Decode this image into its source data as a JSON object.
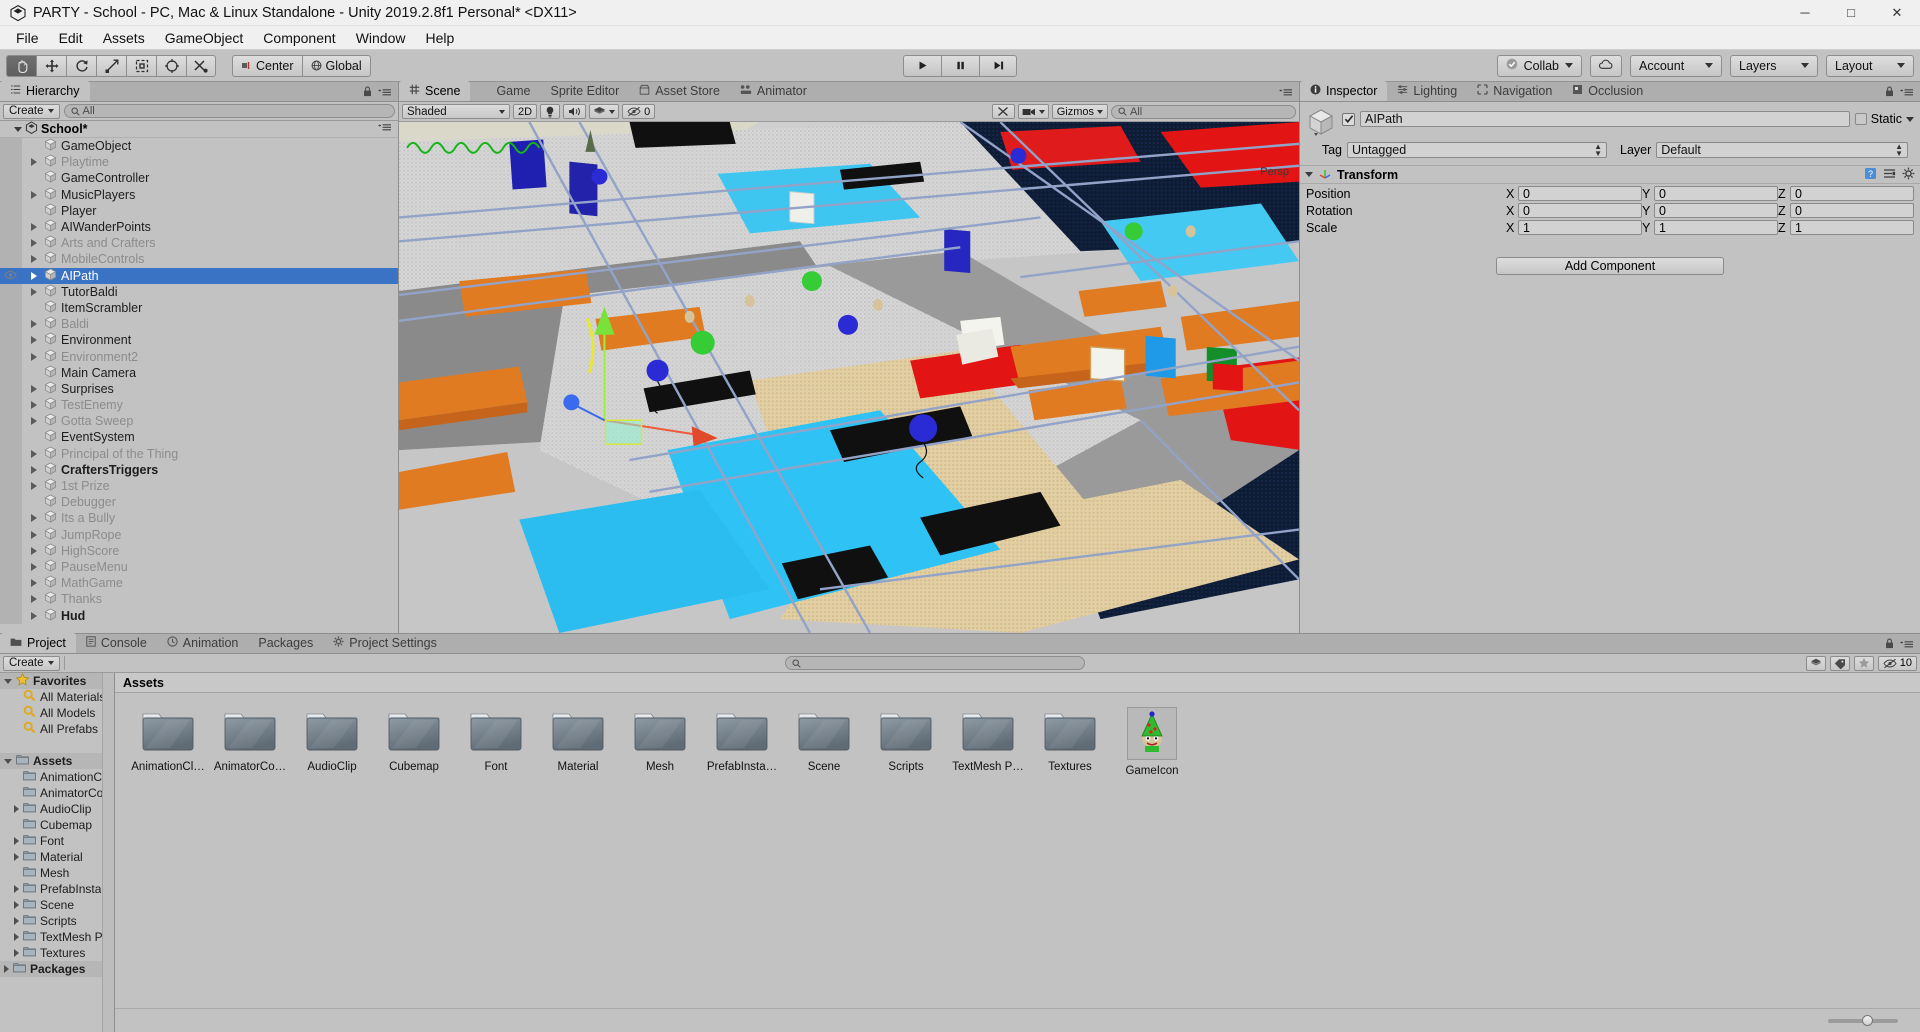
{
  "window": {
    "title": "PARTY - School - PC, Mac & Linux Standalone - Unity 2019.2.8f1 Personal* <DX11>",
    "minimize": "─",
    "maximize": "□",
    "close": "✕"
  },
  "menubar": {
    "items": [
      "File",
      "Edit",
      "Assets",
      "GameObject",
      "Component",
      "Window",
      "Help"
    ]
  },
  "toolbar": {
    "tools": [
      {
        "name": "hand-tool",
        "active": true
      },
      {
        "name": "move-tool",
        "active": false
      },
      {
        "name": "rotate-tool",
        "active": false
      },
      {
        "name": "scale-tool",
        "active": false
      },
      {
        "name": "rect-tool",
        "active": false
      },
      {
        "name": "transform-tool",
        "active": false
      },
      {
        "name": "custom-editor-tool",
        "active": false
      }
    ],
    "pivot_label": "Center",
    "space_label": "Global",
    "play": "▶",
    "pause": "❙❙",
    "step": "▶❙",
    "collab_label": "Collab",
    "account_label": "Account",
    "layers_label": "Layers",
    "layout_label": "Layout"
  },
  "hierarchy": {
    "tab_label": "Hierarchy",
    "create_label": "Create",
    "search_placeholder": "All",
    "scene_name": "School*",
    "items": [
      {
        "label": "GameObject",
        "expandable": false,
        "dim": false,
        "selected": false
      },
      {
        "label": "Playtime",
        "expandable": true,
        "dim": true,
        "selected": false
      },
      {
        "label": "GameController",
        "expandable": false,
        "dim": false,
        "selected": false
      },
      {
        "label": "MusicPlayers",
        "expandable": true,
        "dim": false,
        "selected": false
      },
      {
        "label": "Player",
        "expandable": false,
        "dim": false,
        "selected": false
      },
      {
        "label": "AIWanderPoints",
        "expandable": true,
        "dim": false,
        "selected": false
      },
      {
        "label": "Arts and Crafters",
        "expandable": true,
        "dim": true,
        "selected": false
      },
      {
        "label": "MobileControls",
        "expandable": true,
        "dim": true,
        "selected": false
      },
      {
        "label": "AIPath",
        "expandable": true,
        "dim": false,
        "selected": true
      },
      {
        "label": "TutorBaldi",
        "expandable": true,
        "dim": false,
        "selected": false
      },
      {
        "label": "ItemScrambler",
        "expandable": false,
        "dim": false,
        "selected": false
      },
      {
        "label": "Baldi",
        "expandable": true,
        "dim": true,
        "selected": false
      },
      {
        "label": "Environment",
        "expandable": true,
        "dim": false,
        "selected": false
      },
      {
        "label": "Environment2",
        "expandable": true,
        "dim": true,
        "selected": false
      },
      {
        "label": "Main Camera",
        "expandable": false,
        "dim": false,
        "selected": false
      },
      {
        "label": "Surprises",
        "expandable": true,
        "dim": false,
        "selected": false
      },
      {
        "label": "TestEnemy",
        "expandable": true,
        "dim": true,
        "selected": false
      },
      {
        "label": "Gotta Sweep",
        "expandable": true,
        "dim": true,
        "selected": false
      },
      {
        "label": "EventSystem",
        "expandable": false,
        "dim": false,
        "selected": false
      },
      {
        "label": "Principal of the Thing",
        "expandable": true,
        "dim": true,
        "selected": false
      },
      {
        "label": "CraftersTriggers",
        "expandable": true,
        "dim": false,
        "selected": false,
        "bold": true
      },
      {
        "label": "1st Prize",
        "expandable": true,
        "dim": true,
        "selected": false
      },
      {
        "label": "Debugger",
        "expandable": false,
        "dim": true,
        "selected": false
      },
      {
        "label": "Its a Bully",
        "expandable": true,
        "dim": true,
        "selected": false
      },
      {
        "label": "JumpRope",
        "expandable": true,
        "dim": true,
        "selected": false
      },
      {
        "label": "HighScore",
        "expandable": true,
        "dim": true,
        "selected": false
      },
      {
        "label": "PauseMenu",
        "expandable": true,
        "dim": true,
        "selected": false
      },
      {
        "label": "MathGame",
        "expandable": true,
        "dim": true,
        "selected": false
      },
      {
        "label": "Thanks",
        "expandable": true,
        "dim": true,
        "selected": false
      },
      {
        "label": "Hud",
        "expandable": true,
        "dim": false,
        "selected": false,
        "bold": true
      }
    ]
  },
  "scene": {
    "tabs": [
      {
        "label": "Scene",
        "icon": "grid-icon",
        "active": true
      },
      {
        "label": "Game",
        "icon": "gamepad-icon",
        "active": false
      },
      {
        "label": "Sprite Editor",
        "icon": "",
        "active": false
      },
      {
        "label": "Asset Store",
        "icon": "store-icon",
        "active": false
      },
      {
        "label": "Animator",
        "icon": "animator-icon",
        "active": false
      }
    ],
    "shading_mode": "Shaded",
    "mode_2d": "2D",
    "audio_count": "0",
    "gizmos_label": "Gizmos",
    "search_placeholder": "All",
    "camera_label": "Persp"
  },
  "inspector": {
    "tabs": [
      {
        "label": "Inspector",
        "icon": "info-icon",
        "active": true
      },
      {
        "label": "Lighting",
        "icon": "lighting-icon",
        "active": false
      },
      {
        "label": "Navigation",
        "icon": "navigation-icon",
        "active": false
      },
      {
        "label": "Occlusion",
        "icon": "occlusion-icon",
        "active": false
      }
    ],
    "object_name": "AIPath",
    "enabled": true,
    "static_label": "Static",
    "tag_label": "Tag",
    "tag_value": "Untagged",
    "layer_label": "Layer",
    "layer_value": "Default",
    "transform": {
      "title": "Transform",
      "rows": [
        {
          "label": "Position",
          "x": "0",
          "y": "0",
          "z": "0"
        },
        {
          "label": "Rotation",
          "x": "0",
          "y": "0",
          "z": "0"
        },
        {
          "label": "Scale",
          "x": "1",
          "y": "1",
          "z": "1"
        }
      ],
      "axes": [
        "X",
        "Y",
        "Z"
      ]
    },
    "add_component_label": "Add Component"
  },
  "project": {
    "tabs": [
      {
        "label": "Project",
        "icon": "folder-icon",
        "active": true
      },
      {
        "label": "Console",
        "icon": "console-icon",
        "active": false
      },
      {
        "label": "Animation",
        "icon": "clock-icon",
        "active": false
      },
      {
        "label": "Packages",
        "icon": "",
        "active": false
      },
      {
        "label": "Project Settings",
        "icon": "gear-icon",
        "active": false
      }
    ],
    "create_label": "Create",
    "search_placeholder": "",
    "hidden_count": "10",
    "breadcrumb": "Assets",
    "tree": [
      {
        "label": "Favorites",
        "icon": "star-icon",
        "indent": 0,
        "tri": "open",
        "header": true
      },
      {
        "label": "All Materials",
        "icon": "search-icon",
        "indent": 1,
        "tri": "none",
        "header": false
      },
      {
        "label": "All Models",
        "icon": "search-icon",
        "indent": 1,
        "tri": "none",
        "header": false
      },
      {
        "label": "All Prefabs",
        "icon": "search-icon",
        "indent": 1,
        "tri": "none",
        "header": false
      },
      {
        "label": "",
        "icon": "",
        "indent": 0,
        "tri": "none",
        "header": false
      },
      {
        "label": "Assets",
        "icon": "folder-icon",
        "indent": 0,
        "tri": "open",
        "header": true
      },
      {
        "label": "AnimationC",
        "icon": "folder-icon",
        "indent": 1,
        "tri": "none",
        "header": false
      },
      {
        "label": "AnimatorCo",
        "icon": "folder-icon",
        "indent": 1,
        "tri": "none",
        "header": false
      },
      {
        "label": "AudioClip",
        "icon": "folder-icon",
        "indent": 1,
        "tri": "closed",
        "header": false
      },
      {
        "label": "Cubemap",
        "icon": "folder-icon",
        "indent": 1,
        "tri": "none",
        "header": false
      },
      {
        "label": "Font",
        "icon": "folder-icon",
        "indent": 1,
        "tri": "closed",
        "header": false
      },
      {
        "label": "Material",
        "icon": "folder-icon",
        "indent": 1,
        "tri": "closed",
        "header": false
      },
      {
        "label": "Mesh",
        "icon": "folder-icon",
        "indent": 1,
        "tri": "none",
        "header": false
      },
      {
        "label": "PrefabInsta",
        "icon": "folder-icon",
        "indent": 1,
        "tri": "closed",
        "header": false
      },
      {
        "label": "Scene",
        "icon": "folder-icon",
        "indent": 1,
        "tri": "closed",
        "header": false
      },
      {
        "label": "Scripts",
        "icon": "folder-icon",
        "indent": 1,
        "tri": "closed",
        "header": false
      },
      {
        "label": "TextMesh P",
        "icon": "folder-icon",
        "indent": 1,
        "tri": "closed",
        "header": false
      },
      {
        "label": "Textures",
        "icon": "folder-icon",
        "indent": 1,
        "tri": "closed",
        "header": false
      },
      {
        "label": "Packages",
        "icon": "folder-icon",
        "indent": 0,
        "tri": "closed",
        "header": true
      }
    ],
    "assets": [
      {
        "label": "AnimationCl…",
        "type": "folder"
      },
      {
        "label": "AnimatorCo…",
        "type": "folder"
      },
      {
        "label": "AudioClip",
        "type": "folder"
      },
      {
        "label": "Cubemap",
        "type": "folder"
      },
      {
        "label": "Font",
        "type": "folder"
      },
      {
        "label": "Material",
        "type": "folder"
      },
      {
        "label": "Mesh",
        "type": "folder"
      },
      {
        "label": "PrefabInsta…",
        "type": "folder"
      },
      {
        "label": "Scene",
        "type": "folder"
      },
      {
        "label": "Scripts",
        "type": "folder"
      },
      {
        "label": "TextMesh P…",
        "type": "folder"
      },
      {
        "label": "Textures",
        "type": "folder"
      },
      {
        "label": "GameIcon",
        "type": "image"
      }
    ]
  },
  "colors": {
    "chrome": "#c2c2c2",
    "tabstrip": "#aeaeae",
    "selection": "#3a72c4",
    "scene_sky": "#8f99ab",
    "folder": "#6e7a85"
  }
}
